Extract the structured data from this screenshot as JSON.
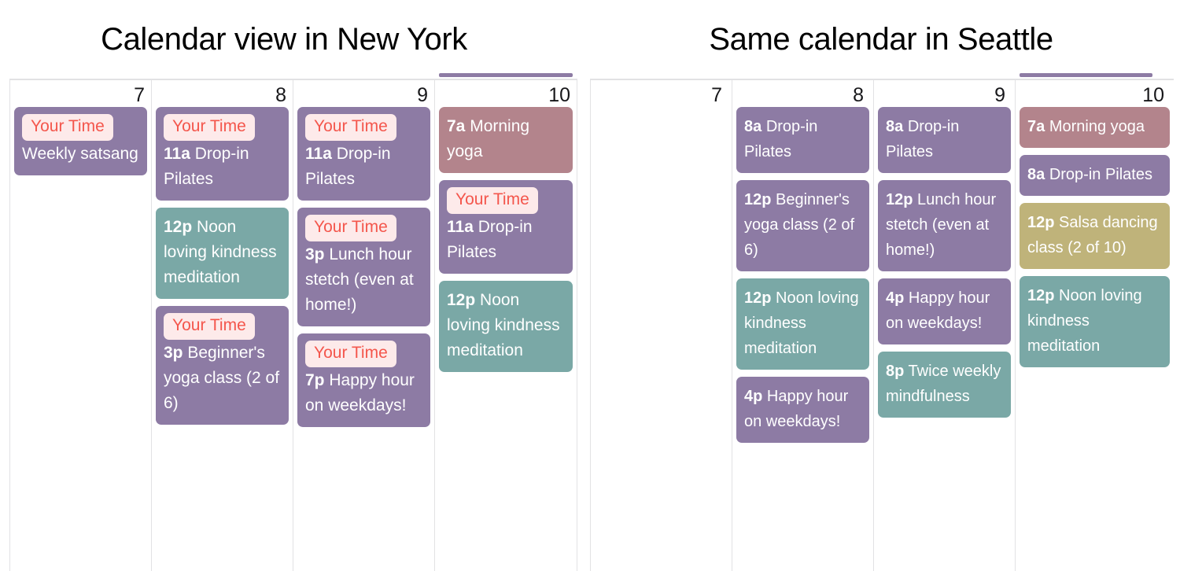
{
  "colors": {
    "purple": "#8d7ba4",
    "teal": "#7aa8a6",
    "rose": "#b3848c",
    "khaki": "#bfb37a",
    "redaction_bg": "#fdeaea",
    "redaction_text": "#f4564c",
    "grid_line": "#e2e2e4",
    "event_text": "#ffffff",
    "day_number": "#17171a"
  },
  "left_calendar": {
    "title": "Calendar view in New York",
    "overflow_bar_color": "#8d7ba4",
    "days": [
      {
        "number": "7",
        "events": [
          {
            "redacted_label": "Your Time",
            "time": "",
            "title": "Weekly satsang",
            "color": "purple"
          }
        ]
      },
      {
        "number": "8",
        "events": [
          {
            "redacted_label": "Your Time",
            "time": "11a",
            "title": "Drop-in Pilates",
            "color": "purple"
          },
          {
            "redacted_label": "",
            "time": "12p",
            "title": "Noon loving kindness meditation",
            "color": "teal"
          },
          {
            "redacted_label": "Your Time",
            "time": "3p",
            "title": "Beginner's yoga class (2 of 6)",
            "color": "purple"
          }
        ]
      },
      {
        "number": "9",
        "events": [
          {
            "redacted_label": "Your Time",
            "time": "11a",
            "title": "Drop-in Pilates",
            "color": "purple"
          },
          {
            "redacted_label": "Your Time",
            "time": "3p",
            "title": "Lunch hour stetch (even at home!)",
            "color": "purple"
          },
          {
            "redacted_label": "Your Time",
            "time": "7p",
            "title": "Happy hour on weekdays!",
            "color": "purple"
          }
        ]
      },
      {
        "number": "10",
        "events": [
          {
            "redacted_label": "",
            "time": "7a",
            "title": "Morning yoga",
            "color": "rose"
          },
          {
            "redacted_label": "Your Time",
            "time": "11a",
            "title": "Drop-in Pilates",
            "color": "purple"
          },
          {
            "redacted_label": "",
            "time": "12p",
            "title": "Noon loving kindness meditation",
            "color": "teal"
          }
        ]
      }
    ]
  },
  "right_calendar": {
    "title": "Same calendar in Seattle",
    "overflow_bar_color": "#8d7ba4",
    "days": [
      {
        "number": "7",
        "events": []
      },
      {
        "number": "8",
        "events": [
          {
            "redacted_label": "",
            "time": "8a",
            "title": "Drop-in Pilates",
            "color": "purple"
          },
          {
            "redacted_label": "",
            "time": "12p",
            "title": "Beginner's yoga class (2 of 6)",
            "color": "purple"
          },
          {
            "redacted_label": "",
            "time": "12p",
            "title": "Noon loving kindness meditation",
            "color": "teal"
          },
          {
            "redacted_label": "",
            "time": "4p",
            "title": "Happy hour on weekdays!",
            "color": "purple"
          }
        ]
      },
      {
        "number": "9",
        "events": [
          {
            "redacted_label": "",
            "time": "8a",
            "title": "Drop-in Pilates",
            "color": "purple"
          },
          {
            "redacted_label": "",
            "time": "12p",
            "title": "Lunch hour stetch (even at home!)",
            "color": "purple"
          },
          {
            "redacted_label": "",
            "time": "4p",
            "title": "Happy hour on weekdays!",
            "color": "purple"
          },
          {
            "redacted_label": "",
            "time": "8p",
            "title": "Twice weekly mindfulness",
            "color": "teal"
          }
        ]
      },
      {
        "number": "10",
        "events": [
          {
            "redacted_label": "",
            "time": "7a",
            "title": "Morning yoga",
            "color": "rose"
          },
          {
            "redacted_label": "",
            "time": "8a",
            "title": "Drop-in Pilates",
            "color": "purple"
          },
          {
            "redacted_label": "",
            "time": "12p",
            "title": "Salsa dancing class (2 of 10)",
            "color": "khaki"
          },
          {
            "redacted_label": "",
            "time": "12p",
            "title": "Noon loving kindness meditation",
            "color": "teal"
          }
        ]
      }
    ]
  }
}
